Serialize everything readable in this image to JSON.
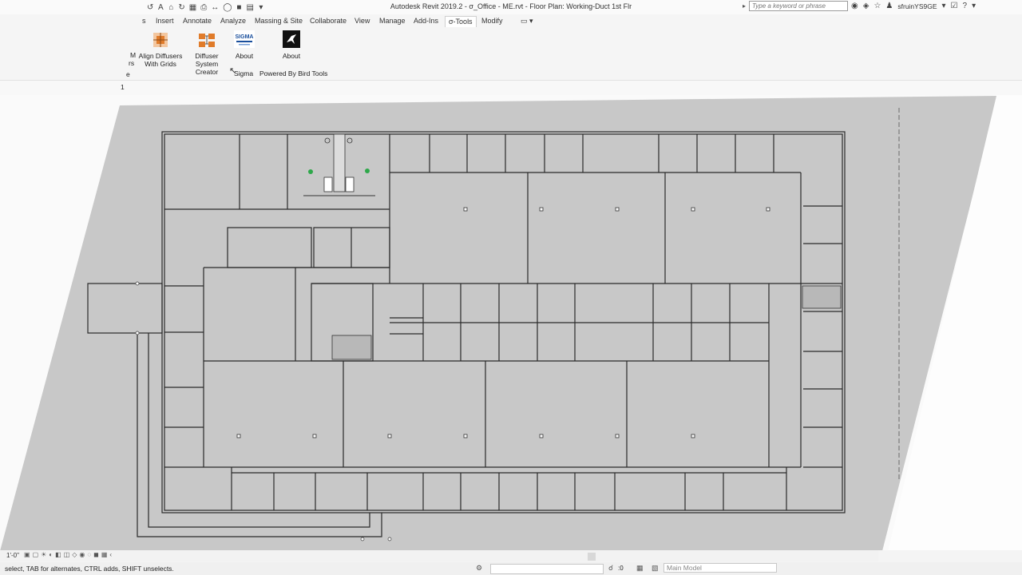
{
  "window": {
    "title": "Autodesk Revit 2019.2 - σ_Office - ME.rvt - Floor Plan: Working-Duct 1st Flr"
  },
  "qat": {
    "icons": [
      "undo-icon",
      "text-icon",
      "home-icon",
      "save-icon",
      "grid-icon",
      "print-icon",
      "measure-icon",
      "align-icon",
      "tag-icon",
      "switch-icon",
      "arrow-icon"
    ],
    "text_a": "A"
  },
  "search": {
    "placeholder": "Type a keyword or phrase"
  },
  "header": {
    "user": "sfruinYS9GE",
    "help": "?"
  },
  "tabs": [
    {
      "label": "s"
    },
    {
      "label": "Insert"
    },
    {
      "label": "Annotate"
    },
    {
      "label": "Analyze"
    },
    {
      "label": "Massing & Site"
    },
    {
      "label": "Collaborate"
    },
    {
      "label": "View"
    },
    {
      "label": "Manage"
    },
    {
      "label": "Add-Ins"
    },
    {
      "label": "σ-Tools"
    },
    {
      "label": "Modify"
    }
  ],
  "ribbon": {
    "partial_left": {
      "line1": "M",
      "line2": "rs",
      "line3": "e"
    },
    "align": {
      "line1": "Align Diffusers",
      "line2": "With Grids"
    },
    "diffuser": {
      "line1": "Diffuser",
      "line2": "System Creator"
    },
    "about_sigma": {
      "label": "About",
      "logo_text": "SIGMA"
    },
    "about_bird": {
      "label": "About"
    },
    "panel_sigma": "Sigma",
    "panel_bird": "Powered By Bird Tools"
  },
  "panelbar": {
    "label": "1"
  },
  "viewcontrol": {
    "scale": "1'-0\""
  },
  "status": {
    "text": "select, TAB for alternates, CTRL adds, SHIFT unselects.",
    "filter_count": ":0",
    "model": "Main Model"
  },
  "colors": {
    "canvas": "#c8c8c8",
    "wall": "#2a2a2a",
    "accent_green": "#2ea84a",
    "ribbon_orange": "#e07b2a"
  }
}
